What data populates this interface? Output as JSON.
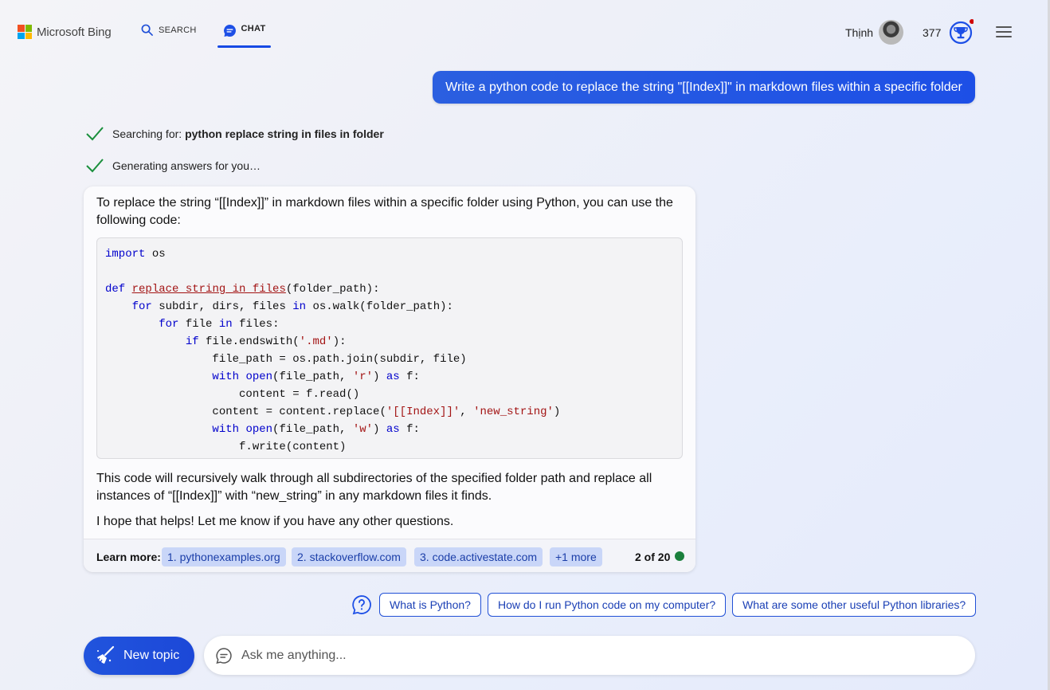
{
  "header": {
    "logo_text": "Microsoft Bing",
    "logo_colors": [
      "#f25022",
      "#7fba00",
      "#00a4ef",
      "#ffb900"
    ],
    "nav": {
      "search_label": "SEARCH",
      "chat_label": "CHAT"
    },
    "user_name": "Thịnh",
    "points": "377",
    "accent": "#174ae4",
    "notification_color": "#d00000"
  },
  "conversation": {
    "user_message": "Write a python code to replace the string \"[[Index]]\" in markdown files within a specific folder",
    "status": {
      "searching_prefix": "Searching for: ",
      "searching_query": "python replace string in files in folder",
      "generating": "Generating answers for you…"
    },
    "answer": {
      "intro": "To replace the string “[[Index]]” in markdown files within a specific folder using Python, you can use the following code:",
      "code": [
        "import os",
        "",
        "def replace_string_in_files(folder_path):",
        "    for subdir, dirs, files in os.walk(folder_path):",
        "        for file in files:",
        "            if file.endswith('.md'):",
        "                file_path = os.path.join(subdir, file)",
        "                with open(file_path, 'r') as f:",
        "                    content = f.read()",
        "                content = content.replace('[[Index]]', 'new_string')",
        "                with open(file_path, 'w') as f:",
        "                    f.write(content)"
      ],
      "explanation": "This code will recursively walk through all subdirectories of the specified folder path and replace all instances of “[[Index]]” with “new_string” in any markdown files it finds.",
      "closing": "I hope that helps! Let me know if you have any other questions."
    },
    "learn_more": {
      "label": "Learn more:",
      "sources": [
        "1. pythonexamples.org",
        "2. stackoverflow.com",
        "3. code.activestate.com",
        "+1 more"
      ],
      "turn_counter": "2 of 20",
      "status_color": "#1a7f3c"
    }
  },
  "suggestions": [
    "What is Python?",
    "How do I run Python code on my computer?",
    "What are some other useful Python libraries?"
  ],
  "composer": {
    "new_topic_label": "New topic",
    "placeholder": "Ask me anything..."
  }
}
